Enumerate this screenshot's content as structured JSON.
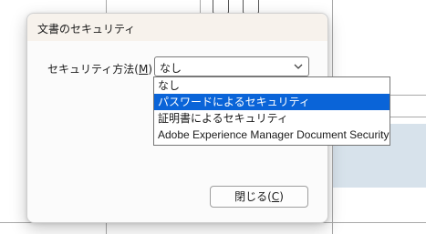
{
  "dialog": {
    "title": "文書のセキュリティ",
    "method_label": "セキュリティ方法(M)：",
    "method_label_mnemonic": "M",
    "method_selected": "なし",
    "close_label": "閉じる(C)",
    "close_mnemonic": "C"
  },
  "dropdown": {
    "options": [
      "なし",
      "パスワードによるセキュリティ",
      "証明書によるセキュリティ",
      "Adobe Experience Manager Document Security"
    ],
    "highlighted_index": 1
  },
  "colors": {
    "highlight": "#0a64d8",
    "title_bar": "#f7f2ec",
    "background_panel": "#d7e2eb"
  },
  "icons": [
    "chevron-down-icon",
    "document-icon",
    "page-icon"
  ]
}
